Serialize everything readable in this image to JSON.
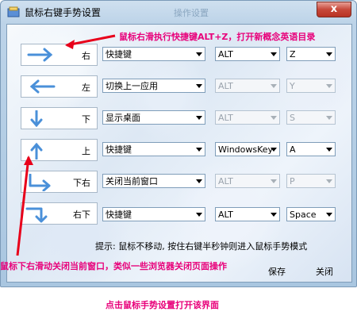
{
  "window": {
    "title": "鼠标右键手势设置",
    "ghost_title": "操作设置",
    "close_label": "x"
  },
  "rows": [
    {
      "label": "右",
      "action": "快捷键",
      "mod": "ALT",
      "key": "Z",
      "enabled": true,
      "icon": "arrow-right-icon"
    },
    {
      "label": "左",
      "action": "切换上一应用",
      "mod": "ALT",
      "key": "Y",
      "enabled": false,
      "icon": "arrow-left-icon"
    },
    {
      "label": "下",
      "action": "显示桌面",
      "mod": "ALT",
      "key": "S",
      "enabled": false,
      "icon": "arrow-down-icon"
    },
    {
      "label": "上",
      "action": "快捷键",
      "mod": "WindowsKey",
      "key": "A",
      "enabled": true,
      "icon": "arrow-up-icon"
    },
    {
      "label": "下右",
      "action": "关闭当前窗口",
      "mod": "ALT",
      "key": "P",
      "enabled": false,
      "icon": "arrow-down-right-icon"
    },
    {
      "label": "右下",
      "action": "快捷键",
      "mod": "ALT",
      "key": "Space",
      "enabled": true,
      "icon": "arrow-right-down-icon"
    }
  ],
  "hint": "提示: 鼠标不移动, 按住右键半秒钟则进入鼠标手势模式",
  "buttons": {
    "save": "保存",
    "close": "关闭"
  },
  "annotations": {
    "top": "鼠标右滑执行快捷键ALT+Z，打开新概念英语目录",
    "bottom": "鼠标下右滑动关闭当前窗口，类似一些浏览器关闭页面操作",
    "caption": "点击鼠标手势设置打开该界面"
  },
  "colors": {
    "annotation": "#e8007a",
    "arrow_icon": "#4a90d9"
  }
}
